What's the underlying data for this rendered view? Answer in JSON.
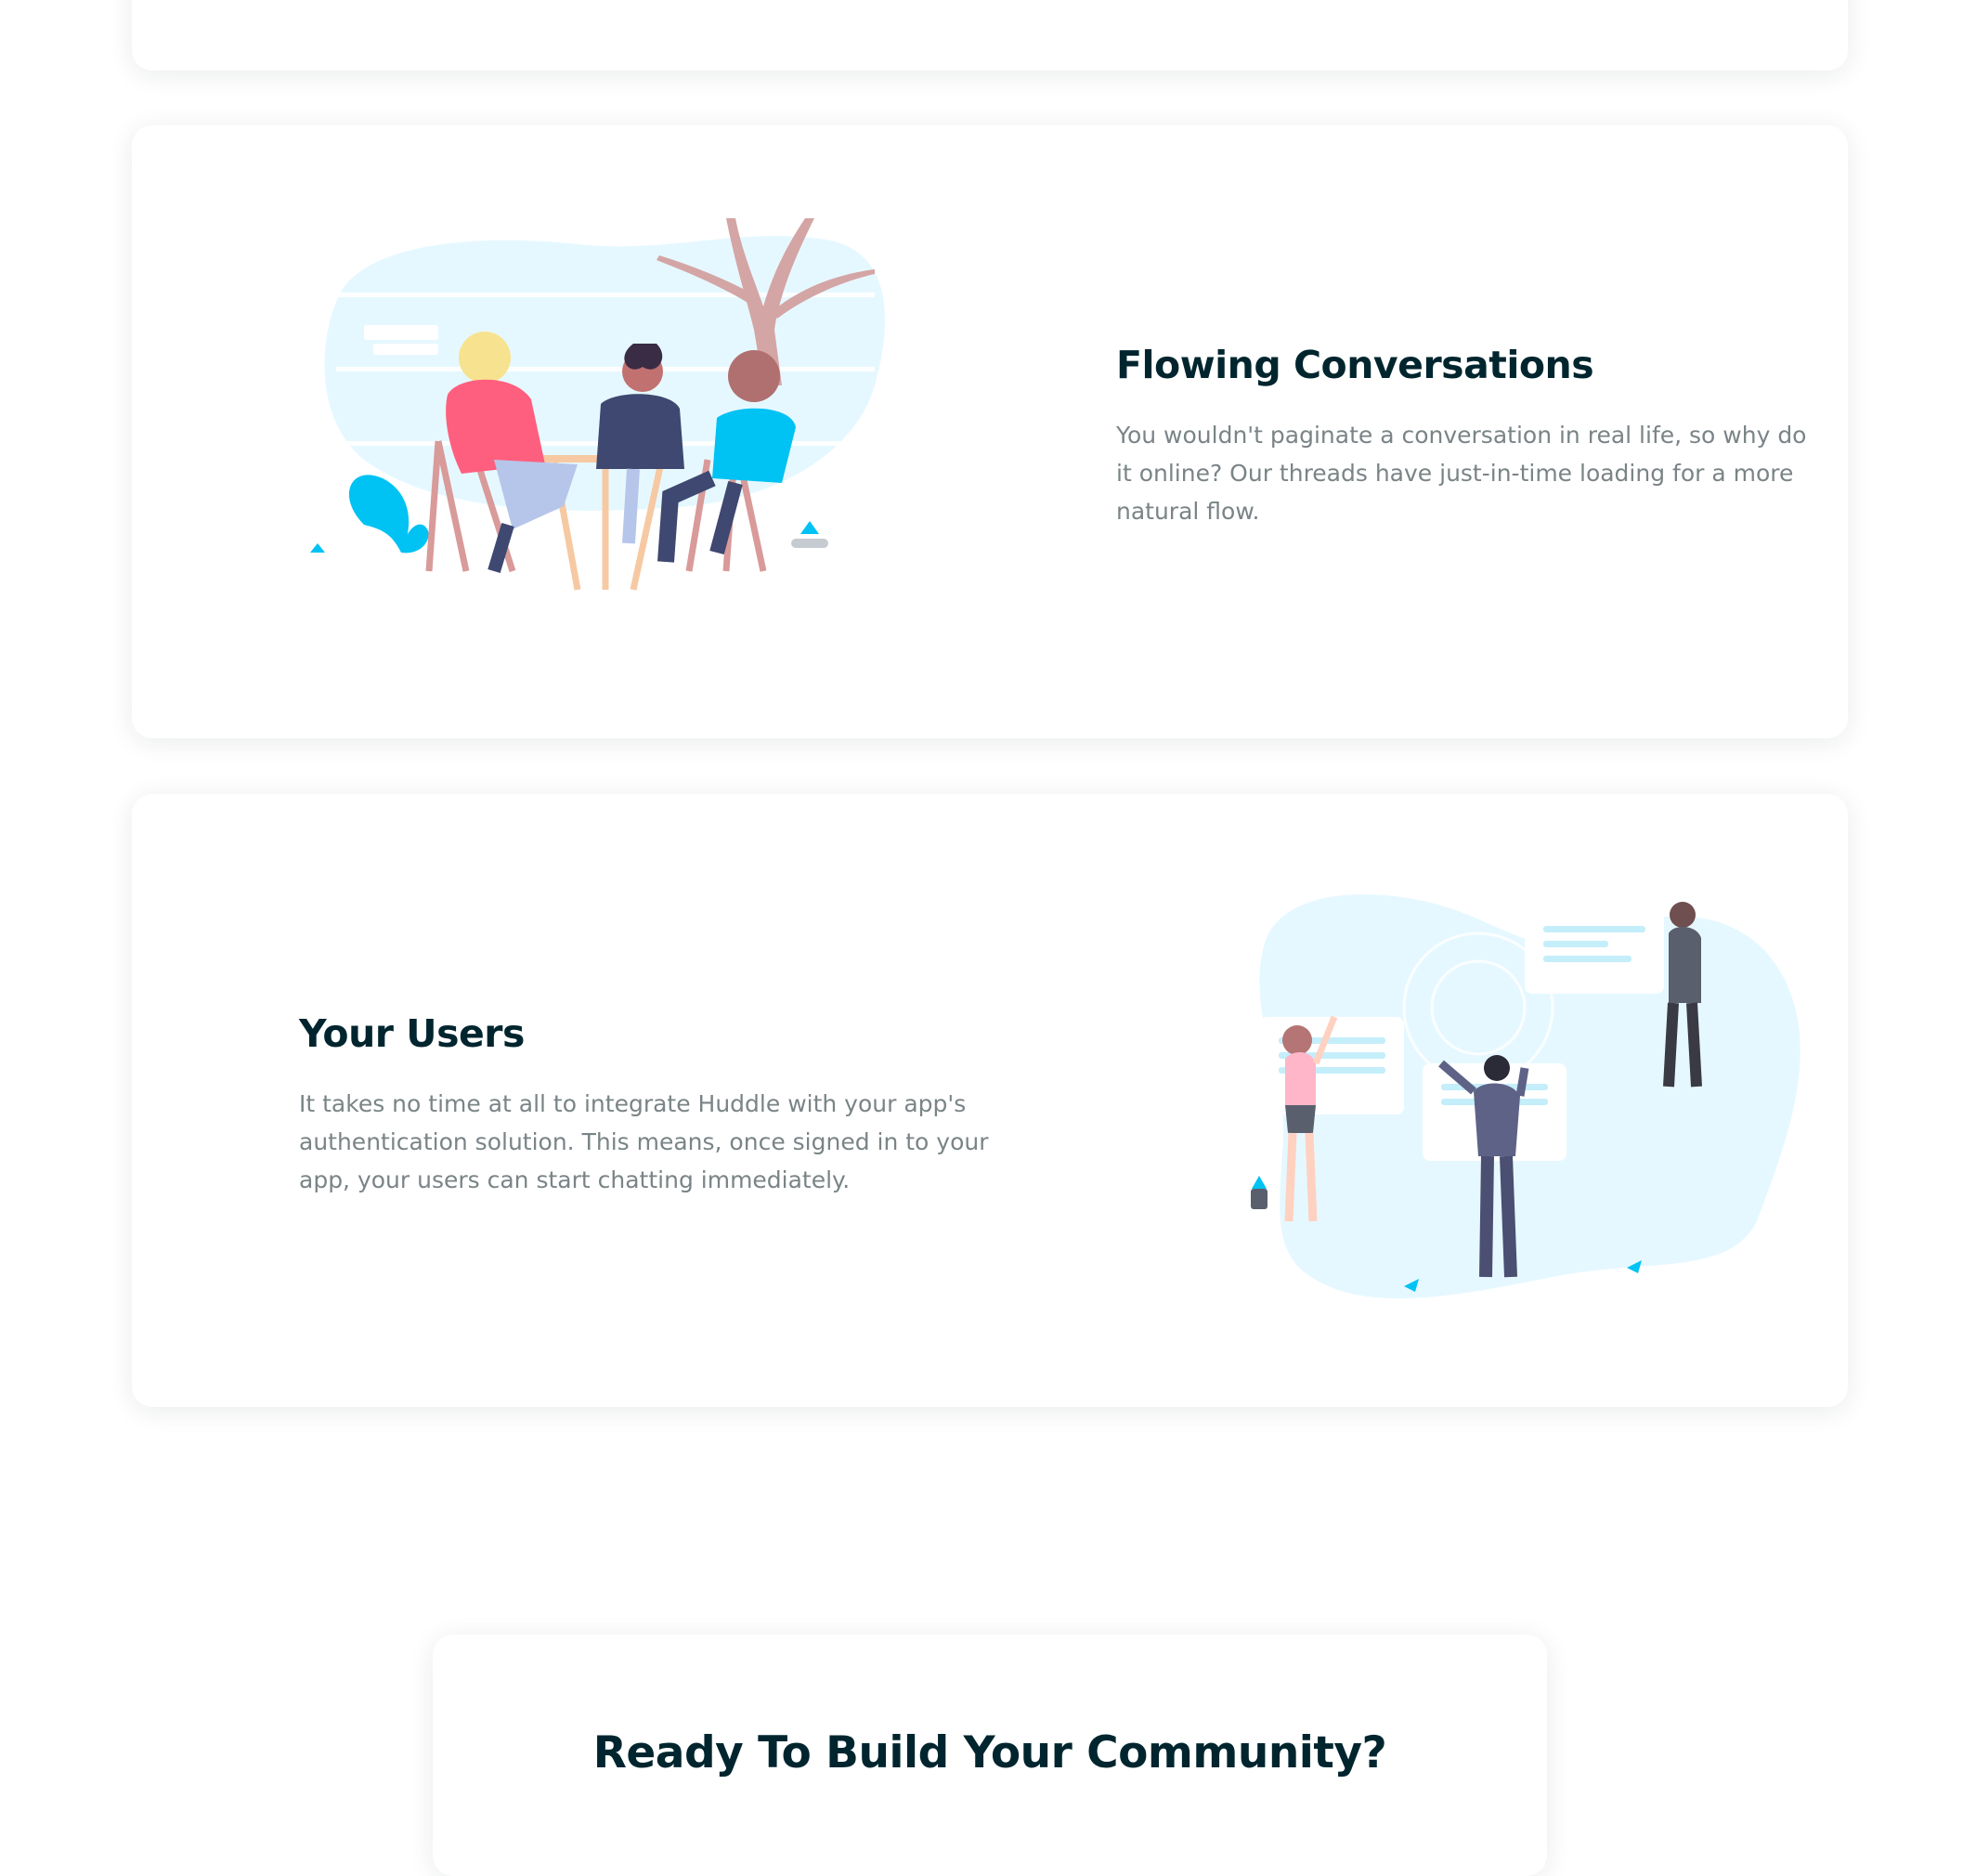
{
  "colors": {
    "heading": "#00252e",
    "body_text": "#7a8486",
    "accent_pink": "#ff5f7e",
    "illustration_bg": "#e6f8ff",
    "accent_cyan": "#00c2f3"
  },
  "features": [
    {
      "title": "Flowing Conversations",
      "text": "You wouldn't paginate a conversation in real life, so why do it online? Our threads have just-in-time loading for a more natural flow.",
      "illustration": "people-talking-at-table-illustration"
    },
    {
      "title": "Your Users",
      "text": "It takes no time at all to integrate Huddle with your app's authentication solution. This means, once signed in to your app, your users can start chatting immediately.",
      "illustration": "users-with-chat-bubbles-illustration"
    }
  ],
  "cta": {
    "title": "Ready To Build Your Community?"
  }
}
